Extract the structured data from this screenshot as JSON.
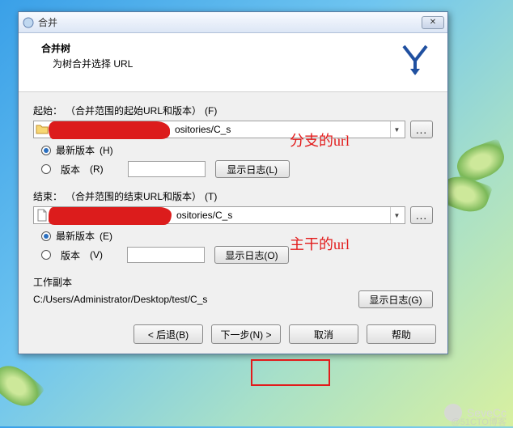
{
  "titlebar": {
    "title": "合并"
  },
  "header": {
    "title": "合并树",
    "subtitle": "为树合并选择 URL"
  },
  "start": {
    "label_prefix": "起始：",
    "label_text": "（合并范围的起始URL和版本）",
    "shortcut": "(F)",
    "url_visible": "ositories/C_s",
    "latest_label": "最新版本",
    "latest_shortcut": "(H)",
    "version_label": "版本",
    "version_shortcut": "(R)",
    "log_btn": "显示日志(L)",
    "annotation": "分支的url"
  },
  "end": {
    "label_prefix": "结束：",
    "label_text": "（合并范围的结束URL和版本）",
    "shortcut": "(T)",
    "url_visible": "ositories/C_s",
    "latest_label": "最新版本",
    "latest_shortcut": "(E)",
    "version_label": "版本",
    "version_shortcut": "(V)",
    "log_btn": "显示日志(O)",
    "annotation": "主干的url"
  },
  "wc": {
    "label": "工作副本",
    "path": "C:/Users/Administrator/Desktop/test/C_s",
    "log_btn": "显示日志(G)"
  },
  "footer": {
    "back": "< 后退(B)",
    "next": "下一步(N) >",
    "cancel": "取消",
    "help": "帮助"
  },
  "browse": "...",
  "watermark": "SeveCc",
  "watermark2": "@51CTO博客"
}
